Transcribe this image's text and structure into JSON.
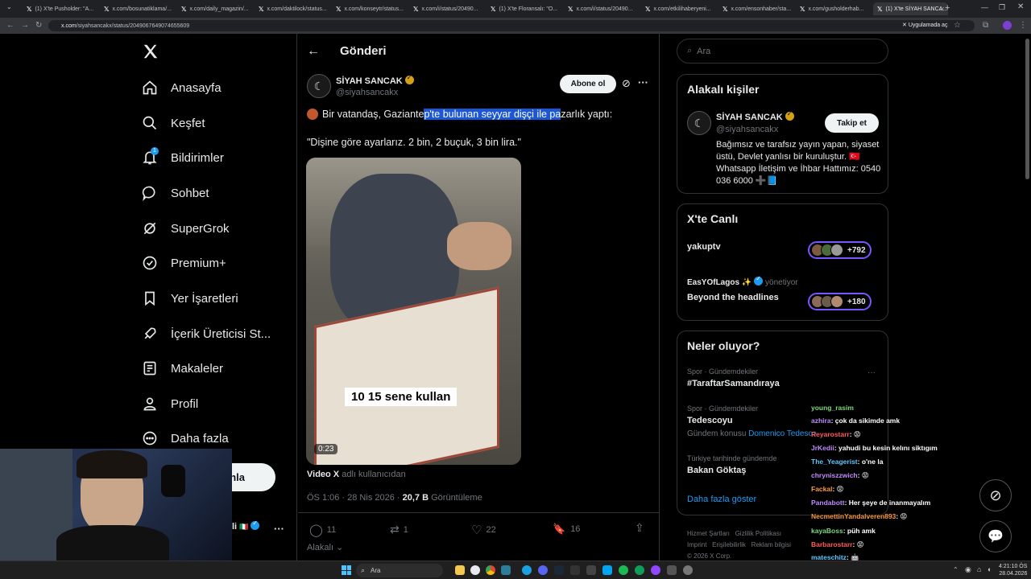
{
  "browser": {
    "tabs": [
      {
        "label": "(1) X'te Pusholder: \"A..."
      },
      {
        "label": "x.com/bosunatiklama/..."
      },
      {
        "label": "x.com/daily_magazin/..."
      },
      {
        "label": "x.com/daktilock/status..."
      },
      {
        "label": "x.com/konseytr/status..."
      },
      {
        "label": "x.com/i/status/20490..."
      },
      {
        "label": "(1) X'te Floransalı: \"O..."
      },
      {
        "label": "x.com/i/status/20490..."
      },
      {
        "label": "x.com/etkilihaberyeni..."
      },
      {
        "label": "x.com/ensonhaber/sta..."
      },
      {
        "label": "x.com/gusholderhab..."
      },
      {
        "label": "(1) X'te SİYAH SANCA..."
      }
    ],
    "url_host": "x.com",
    "url_path": "/siyahsancakx/status/2049067649074655609",
    "app_prompt": "Uygulamada aç"
  },
  "nav": {
    "items": [
      {
        "label": "Anasayfa",
        "icon": "home-icon"
      },
      {
        "label": "Keşfet",
        "icon": "search-icon"
      },
      {
        "label": "Bildirimler",
        "icon": "bell-icon"
      },
      {
        "label": "Sohbet",
        "icon": "chat-icon"
      },
      {
        "label": "SuperGrok",
        "icon": "grok-icon"
      },
      {
        "label": "Premium+",
        "icon": "verified-icon"
      },
      {
        "label": "Yer İşaretleri",
        "icon": "bookmark-icon"
      },
      {
        "label": "İçerik Üreticisi St...",
        "icon": "rocket-icon"
      },
      {
        "label": "Makaleler",
        "icon": "article-icon"
      },
      {
        "label": "Profil",
        "icon": "person-icon"
      },
      {
        "label": "Daha fazla",
        "icon": "more-circle-icon"
      }
    ],
    "notification_badge": "1",
    "post_button": "nla",
    "account_short": "li"
  },
  "post": {
    "header_title": "Gönderi",
    "author_name": "SİYAH SANCAK",
    "author_handle": "@siyahsancakx",
    "subscribe_label": "Abone ol",
    "text_prefix": "Bir vatandaş, Gaziante",
    "text_selected": "p'te bulunan seyyar dişçi ile pa",
    "text_suffix": "zarlık yaptı:",
    "quote": "\"Dişine göre ayarlarız. 2 bin, 2 buçuk, 3 bin lira.\"",
    "video_caption": "10 15 sene kullan",
    "video_duration": "0:23",
    "video_source_name": "Video X",
    "video_source_suffix": "adlı kullanıcıdan",
    "timestamp": "ÖS 1:06 · 28 Nis 2026 · ",
    "views": "20,7 B",
    "views_label": "Görüntüleme",
    "replies": "11",
    "reposts": "1",
    "likes": "22",
    "bookmarks": "16",
    "reply_audience": "Alakalı"
  },
  "right": {
    "search_placeholder": "Ara",
    "relevant_title": "Alakalı kişiler",
    "relevant_name": "SİYAH SANCAK",
    "relevant_handle": "@siyahsancakx",
    "follow_label": "Takip et",
    "relevant_bio": "Bağımsız ve tarafsız yayın yapan, siyaset üstü, Devlet yanlısı bir kuruluştur. 🇹🇷 Whatsapp İletişim ve İhbar Hattımız: 0540 036 6000 ➕📘",
    "live_title": "X'te Canlı",
    "live1_name": "yakuptv",
    "live1_count": "+792",
    "live2_host": "EasYOfLagos ✨",
    "live2_role": "yönetiyor",
    "live2_title": "Beyond the headlines",
    "live2_count": "+180",
    "trends_title": "Neler oluyor?",
    "trend1_meta": "Spor · Gündemdekiler",
    "trend1_name": "#TaraftarSamandıraya",
    "trend2_meta": "Spor · Gündemdekiler",
    "trend2_name": "Tedescoyu",
    "trend2_sub_prefix": "Gündem konusu",
    "trend2_sub_link": "Domenico Tedesco",
    "trend3_meta": "Türkiye tarihinde gündemde",
    "trend3_name": "Bakan Göktaş",
    "show_more": "Daha fazla göster",
    "footer": [
      "Hizmet Şartları",
      "Gizlilik Politikası",
      "Imprint",
      "Erişilebilirlik",
      "Reklam bilgisi",
      "© 2026 X Corp."
    ]
  },
  "chat": [
    {
      "user": "young_rasim",
      "msg": "",
      "color": "#7fd67f"
    },
    {
      "user": "azhira",
      "msg": ": çok da sikimde amk",
      "color": "#c08cff"
    },
    {
      "user": "Reyarostarr",
      "msg": ": 😡",
      "color": "#ff5c5c"
    },
    {
      "user": "JrKedii",
      "msg": ": yahudi bu kesin kelını siktıgım",
      "color": "#c08cff"
    },
    {
      "user": "The_Yeagerist",
      "msg": ": o'ne la",
      "color": "#5cc8ff"
    },
    {
      "user": "chryniszzwich",
      "msg": ": 😡",
      "color": "#c08cff"
    },
    {
      "user": "Fackal",
      "msg": ": 😡",
      "color": "#ff9a3c"
    },
    {
      "user": "Pandabott",
      "msg": ": Her şeye de inanmayalım",
      "color": "#c08cff"
    },
    {
      "user": "NecmettinYandalveren893",
      "msg": ": 😡",
      "color": "#ff9a3c"
    },
    {
      "user": "kayaBoss",
      "msg": ": püh amk",
      "color": "#7fd67f"
    },
    {
      "user": "Barbarostarr",
      "msg": ": 😡",
      "color": "#ff5c5c"
    },
    {
      "user": "mateschitz",
      "msg": ": 🤖",
      "color": "#5cc8ff"
    }
  ],
  "taskbar": {
    "search_placeholder": "Ara",
    "time": "4:21:10 ÖS",
    "date": "28.04.2026"
  },
  "colors": {
    "accent": "#1d9bf0",
    "live": "#7856ff",
    "selection": "#1a56d6"
  }
}
